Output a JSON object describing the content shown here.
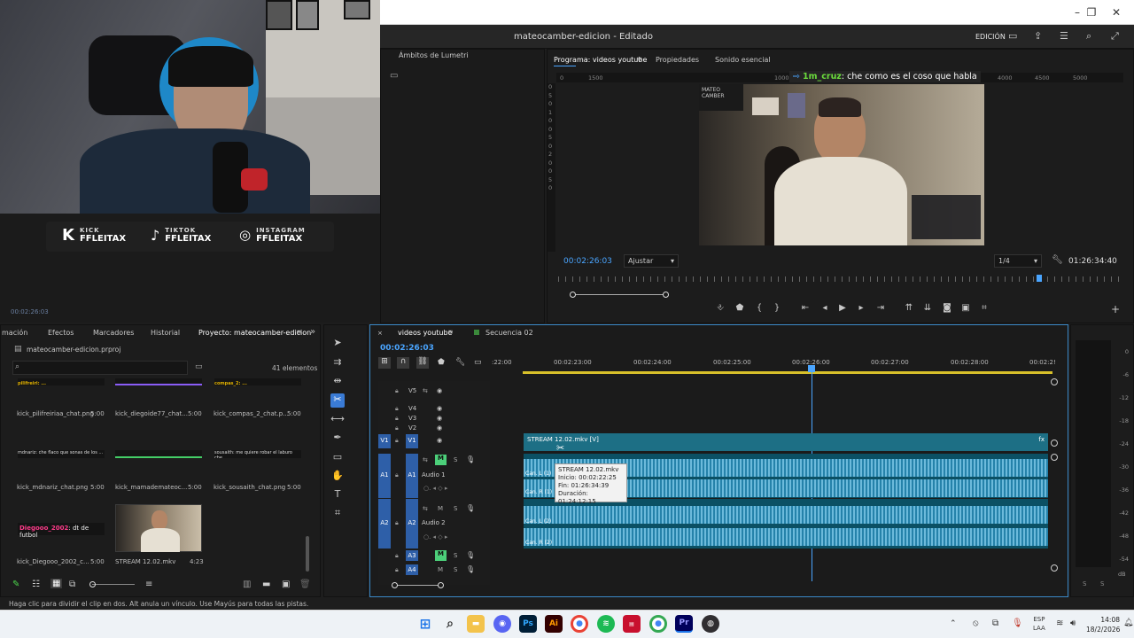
{
  "app": {
    "title": "mateocamber-edicion - Editado",
    "workspace": "EDICIÓN"
  },
  "overlay": {
    "socials": [
      {
        "platform": "KICK",
        "handle": "FFLEITAX"
      },
      {
        "platform": "TIKTOK",
        "handle": "FFLEITAX"
      },
      {
        "platform": "INSTAGRAM",
        "handle": "FFLEITAX"
      }
    ],
    "left_timecode": "00:02:26:03"
  },
  "lumetri": {
    "tab": "Ámbitos de Lumetri"
  },
  "program": {
    "tabs": [
      "Programa: videos youtube",
      "Propiedades",
      "Sonido esencial"
    ],
    "ruler_left": [
      "0",
      "1500",
      "1000"
    ],
    "ruler_right": [
      "4000",
      "4500",
      "5000"
    ],
    "chat_user": "1m_cruz",
    "chat_msg": ": che como es el coso que habla",
    "timecode": "00:02:26:03",
    "fit": "Ajustar",
    "resolution": "1/4",
    "duration": "01:26:34:40",
    "vscale": [
      "0",
      "5",
      "0",
      "1",
      "0",
      "0",
      "5",
      "0",
      "2",
      "0",
      "0",
      "5",
      "0"
    ]
  },
  "project": {
    "tabs": [
      "mación",
      "Efectos",
      "Marcadores",
      "Historial",
      "Proyecto: mateocamber-edicion"
    ],
    "file": "mateocamber-edicion.prproj",
    "search_placeholder": "",
    "count": "41 elementos",
    "items": [
      {
        "name": "kick_pilifreiriaa_chat.png",
        "dur": "5:00",
        "preview": "pilifreiri: ...",
        "accent": "#e0b000"
      },
      {
        "name": "kick_diegoide77_chat...",
        "dur": "5:00",
        "preview": "",
        "accent": "#8a5cf6"
      },
      {
        "name": "kick_compas_2_chat.p...",
        "dur": "5:00",
        "preview": "compas_2: ...",
        "accent": "#e0b000"
      },
      {
        "name": "kick_mdnariz_chat.png",
        "dur": "5:00",
        "preview": "mdnariz: che flaco que sonas de los ...",
        "accent": "#4aa5ff"
      },
      {
        "name": "kick_mamademateoc...",
        "dur": "5:00",
        "preview": "",
        "accent": "#44cc66"
      },
      {
        "name": "kick_sousaith_chat.png",
        "dur": "5:00",
        "preview": "sousaith: me quiere robar el laburo che",
        "accent": "#ff7a1a"
      },
      {
        "name": "kick_Diegooo_2002_c...",
        "dur": "5:00",
        "preview_user": "Diegooo_2002",
        "preview_msg": ": dt de futbol",
        "accent": "#ff3b8a"
      },
      {
        "name": "STREAM 12.02.mkv",
        "dur": "4:23",
        "preview": "",
        "accent": "#4aa5ff"
      }
    ]
  },
  "timeline": {
    "tabs": [
      "videos youtube",
      "Secuencia 02"
    ],
    "timecode": "00:02:26:03",
    "ruler": [
      ":22:00",
      "00:02:23:00",
      "00:02:24:00",
      "00:02:25:00",
      "00:02:26:00",
      "00:02:27:00",
      "00:02:28:00",
      "00:02:2!"
    ],
    "video_tracks": [
      "V5",
      "V4",
      "V3",
      "V2",
      "V1"
    ],
    "audio_tracks": [
      {
        "id": "A1",
        "name": "Audio 1"
      },
      {
        "id": "A2",
        "name": "Audio 2"
      },
      {
        "id": "A3",
        "name": ""
      },
      {
        "id": "A4",
        "name": ""
      }
    ],
    "clip_label": "STREAM 12.02.mkv [V]",
    "ch_labels": [
      "Can. L (1)",
      "Can. R (1)",
      "Can. L (2)",
      "Can. R (2)"
    ],
    "tooltip": {
      "title": "STREAM 12.02.mkv",
      "inicio": "Inicio: 00:02:22:25",
      "fin": "Fin: 01:26:34:39",
      "duracion": "Duración: 01:24:12:15"
    },
    "fx": "fx"
  },
  "meter": {
    "labels": [
      "0",
      "-6",
      "-12",
      "-18",
      "-24",
      "-30",
      "-36",
      "-42",
      "-48",
      "-54"
    ],
    "bottom": "dB",
    "solo": [
      "S",
      "S"
    ]
  },
  "status": "Haga clic para dividir el clip en dos. Alt anula un vínculo. Use Mayús para todas las pistas.",
  "taskbar": {
    "lang1": "ESP",
    "lang2": "LAA",
    "time": "14:08",
    "date": "18/2/2026"
  }
}
